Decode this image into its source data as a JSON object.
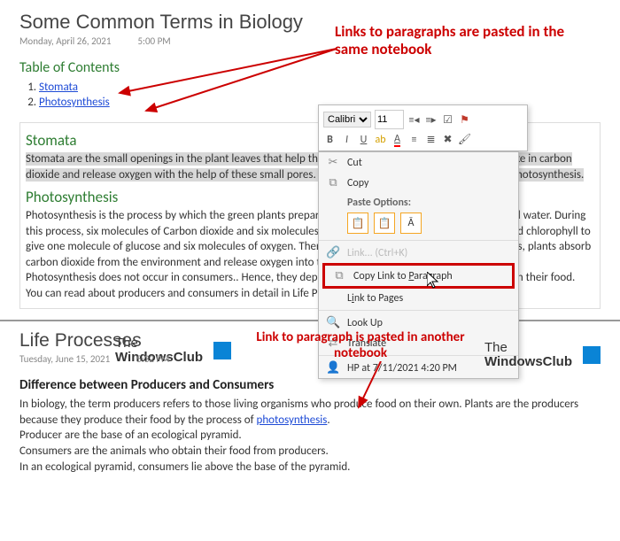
{
  "note1": {
    "title": "Some Common Terms in Biology",
    "date": "Monday, April 26, 2021",
    "time": "5:00 PM",
    "tocHeader": "Table of Contents",
    "toc": [
      "Stomata",
      "Photosynthesis"
    ],
    "stomataHead": "Stomata",
    "stomataBody": "Stomata are the small openings in the plant leaves that help them in the exchange of gases. The plants take in carbon dioxide and release oxygen with the help of these small pores. Stomata also takes part in the process of photosynthesis.",
    "photoHead": "Photosynthesis",
    "photoBody1": "Photosynthesis is the process by which the green plants prepare their food in the presence of sunlight and water. During this process, six molecules of Carbon dioxide and six molecules of water react in the presence of water and chlorophyll to give one molecule of glucose and six molecules of oxygen. Therefore, during the process of photosynthesis, plants absorb carbon dioxide from the environment and release oxygen into the atmosphere.",
    "photoBody2": "Photosynthesis does not occur in consumers.. Hence, they depend on the consumers (producers) to obtain their food. You can read about producers and consumers in detail in Life Processes."
  },
  "annot": {
    "top": "Links to paragraphs are pasted in the same notebook",
    "bottom": "Link to paragraph is pasted in another notebook"
  },
  "toolbar": {
    "font": "Calibri",
    "size": "11"
  },
  "menu": {
    "cut": "Cut",
    "copy": "Copy",
    "pasteLabel": "Paste Options:",
    "link": "Link... (Ctrl+K)",
    "copyPara": "Copy Link to Paragraph",
    "linkPages": "Link to Pages",
    "lookup": "Look Up",
    "translate": "Translate",
    "hp": "HP at 7/11/2021 4:20 PM"
  },
  "logo": {
    "l1": "The",
    "l2": "WindowsClub"
  },
  "note2": {
    "title": "Life Processes",
    "date": "Tuesday, June 15, 2021",
    "time": "5:32 PM",
    "h": "Difference between Producers and Consumers",
    "p1a": "In biology, the term producers refers to those living organisms who produce food on their own. Plants are the producers because they produce their food by the process of ",
    "p1link": "photosynthesis",
    "p1b": ".",
    "p2": "Producer are the base of an ecological pyramid.",
    "p3": "Consumers are the animals who obtain their food from producers.",
    "p4": "In an ecological pyramid, consumers lie above the base of the pyramid."
  }
}
